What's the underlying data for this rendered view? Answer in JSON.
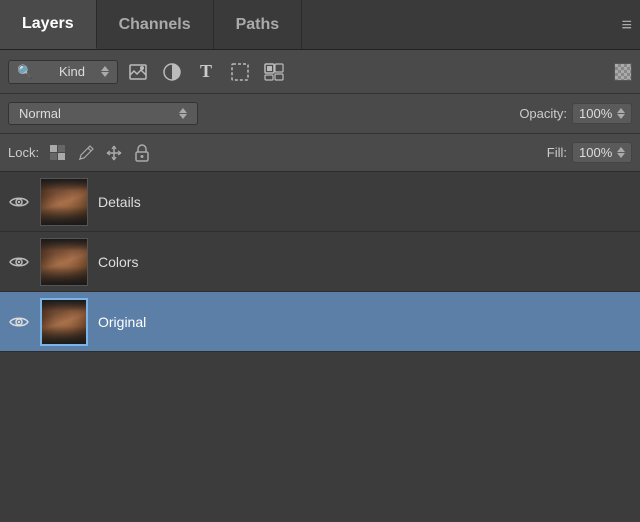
{
  "tabs": [
    {
      "id": "layers",
      "label": "Layers",
      "active": true
    },
    {
      "id": "channels",
      "label": "Channels",
      "active": false
    },
    {
      "id": "paths",
      "label": "Paths",
      "active": false
    }
  ],
  "toolbar": {
    "filter_label": "Kind",
    "blend_mode": "Normal",
    "opacity_label": "Opacity:",
    "opacity_value": "100%",
    "fill_label": "Fill:",
    "fill_value": "100%",
    "lock_label": "Lock:"
  },
  "layers": [
    {
      "id": "details",
      "name": "Details",
      "visible": true,
      "selected": false
    },
    {
      "id": "colors",
      "name": "Colors",
      "visible": true,
      "selected": false
    },
    {
      "id": "original",
      "name": "Original",
      "visible": true,
      "selected": true
    }
  ],
  "icons": {
    "menu": "≡",
    "search": "🔍",
    "eye": "👁",
    "image": "🖼",
    "circle_half": "◑",
    "text_t": "T",
    "select_rect": "⬚",
    "layers_icon": "▣",
    "lock_transparent": "⊞",
    "lock_paint": "✏",
    "lock_move": "✢",
    "lock_all": "🔒",
    "spinner_up": "▲",
    "spinner_down": "▼",
    "dropdown_arrow": "▼"
  }
}
